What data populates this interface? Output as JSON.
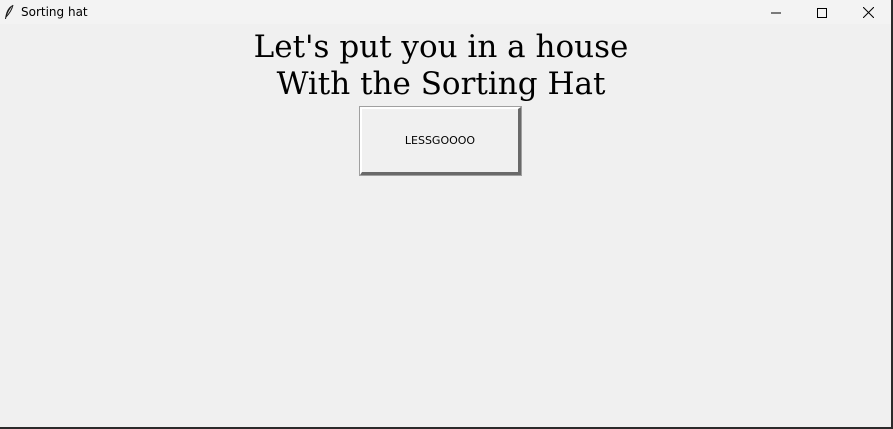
{
  "window": {
    "title": "Sorting hat",
    "icon": "feather-icon",
    "controls": [
      "minimize-icon",
      "maximize-icon",
      "close-icon"
    ]
  },
  "main": {
    "heading_line1": "Let's put you in a house",
    "heading_line2": "With the Sorting Hat",
    "button_label": "LESSGOOOO"
  }
}
